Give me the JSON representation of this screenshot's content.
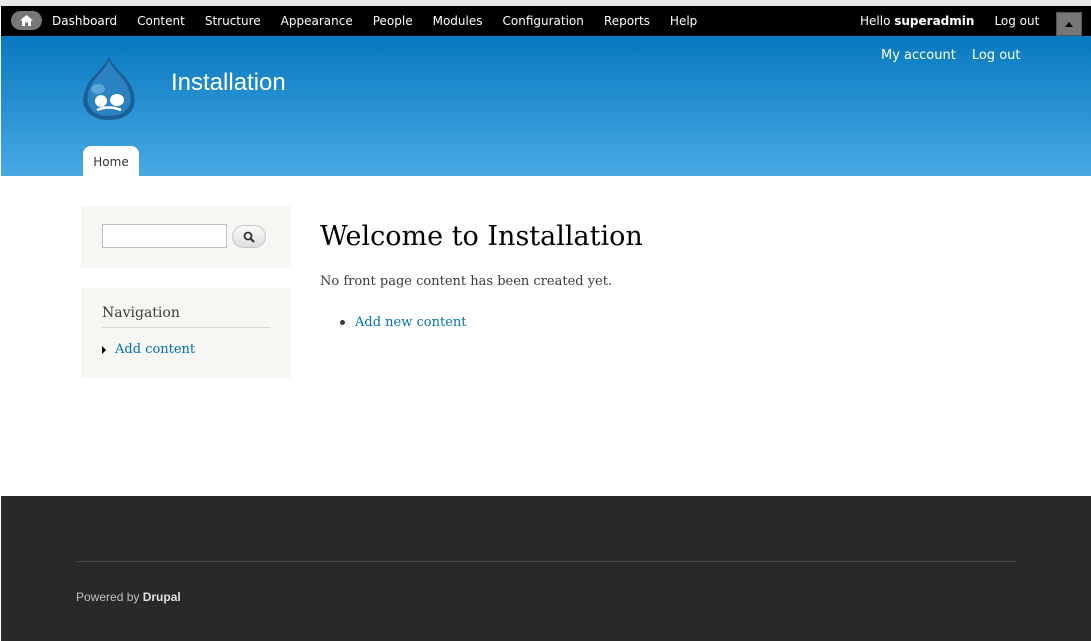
{
  "toolbar": {
    "menu": [
      "Dashboard",
      "Content",
      "Structure",
      "Appearance",
      "People",
      "Modules",
      "Configuration",
      "Reports",
      "Help"
    ],
    "hello_prefix": "Hello",
    "username": "superadmin",
    "logout": "Log out",
    "home_icon": "home-icon",
    "shortcut_icon": "triangle-up-icon"
  },
  "header": {
    "links": [
      "My account",
      "Log out"
    ],
    "site_name": "Installation",
    "tab_home": "Home",
    "logo_icon": "drupal-drop-logo",
    "gradient_top": "#0779bf",
    "gradient_bottom": "#48a9e4"
  },
  "sidebar": {
    "search": {
      "value": "",
      "button_icon": "search-icon"
    },
    "navigation": {
      "title": "Navigation",
      "items": [
        "Add content"
      ]
    }
  },
  "main": {
    "title": "Welcome to Installation",
    "message": "No front page content has been created yet.",
    "actions": [
      "Add new content"
    ]
  },
  "footer": {
    "powered_prefix": "Powered by",
    "powered_link": "Drupal",
    "background": "#292929"
  },
  "colors": {
    "link": "#0071b3",
    "toolbar": "#000000"
  }
}
